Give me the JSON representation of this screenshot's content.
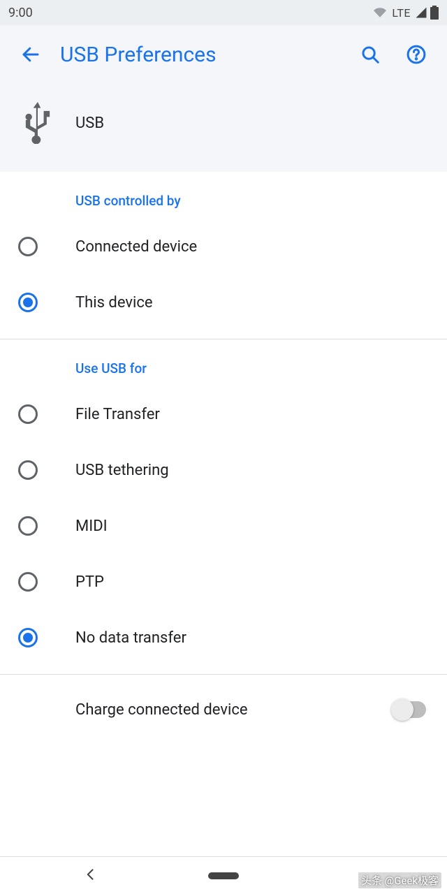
{
  "statusbar": {
    "time": "9:00",
    "network": "LTE"
  },
  "appbar": {
    "title": "USB Preferences"
  },
  "usb_header": {
    "label": "USB"
  },
  "sections": {
    "controlled_by": {
      "title": "USB controlled by",
      "options": [
        {
          "label": "Connected device",
          "checked": false
        },
        {
          "label": "This device",
          "checked": true
        }
      ]
    },
    "use_for": {
      "title": "Use USB for",
      "options": [
        {
          "label": "File Transfer",
          "checked": false
        },
        {
          "label": "USB tethering",
          "checked": false
        },
        {
          "label": "MIDI",
          "checked": false
        },
        {
          "label": "PTP",
          "checked": false
        },
        {
          "label": "No data transfer",
          "checked": true
        }
      ]
    },
    "charge": {
      "label": "Charge connected device",
      "on": false
    }
  },
  "watermark": "头条 @Geek极客"
}
